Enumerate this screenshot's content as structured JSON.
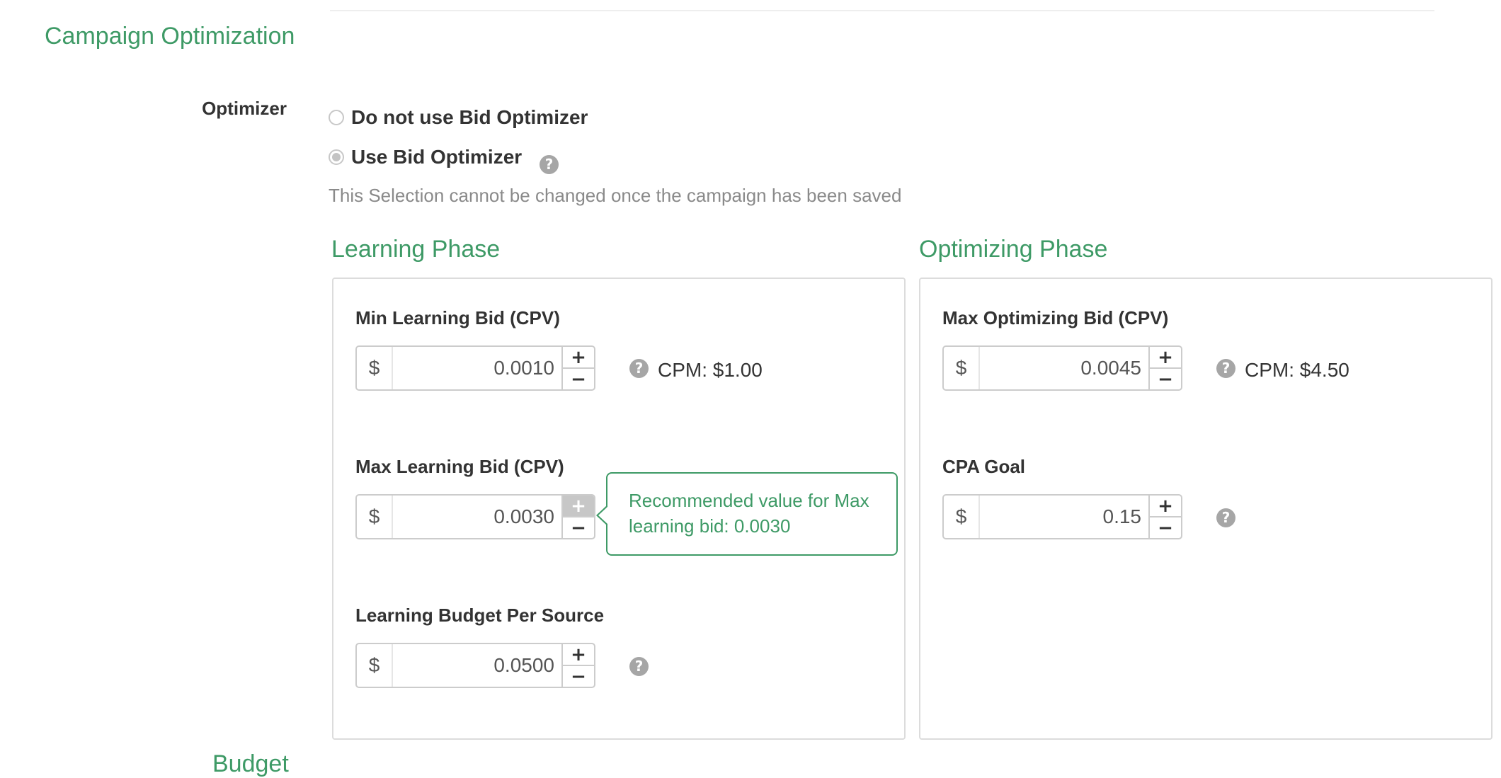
{
  "section": {
    "title": "Campaign Optimization"
  },
  "optimizer": {
    "label": "Optimizer",
    "options": [
      {
        "label": "Do not use Bid Optimizer",
        "checked": false
      },
      {
        "label": "Use Bid Optimizer",
        "checked": true
      }
    ],
    "help_glyph": "?",
    "note": "This Selection cannot be changed once the campaign has been saved"
  },
  "learning_phase": {
    "title": "Learning Phase",
    "min_bid": {
      "label": "Min Learning Bid (CPV)",
      "prefix": "$",
      "value": "0.0010",
      "cpm": "CPM: $1.00"
    },
    "max_bid": {
      "label": "Max Learning Bid (CPV)",
      "prefix": "$",
      "value": "0.0030"
    },
    "budget": {
      "label": "Learning Budget Per Source",
      "prefix": "$",
      "value": "0.0500"
    },
    "tooltip": "Recommended value for Max learning bid: 0.0030"
  },
  "optimizing_phase": {
    "title": "Optimizing Phase",
    "max_bid": {
      "label": "Max Optimizing Bid (CPV)",
      "prefix": "$",
      "value": "0.0045",
      "cpm": "CPM: $4.50"
    },
    "cpa_goal": {
      "label": "CPA Goal",
      "prefix": "$",
      "value": "0.15"
    }
  },
  "stepper": {
    "plus": "+",
    "minus": "−"
  },
  "next_section_partial": "Budget",
  "colors": {
    "accent": "#3e9a66",
    "muted": "#8a8a8a",
    "border": "#cccccc"
  },
  "icons": {
    "help": "question-circle-icon",
    "radio": "radio-button-icon"
  }
}
